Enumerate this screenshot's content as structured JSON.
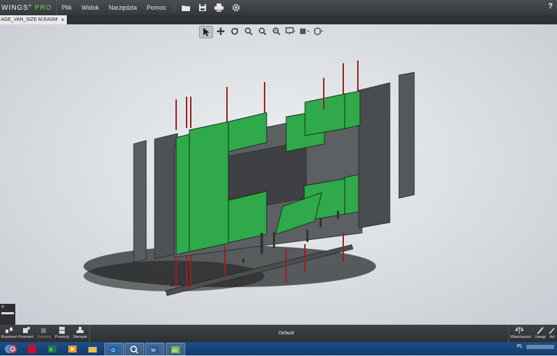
{
  "app": {
    "brand_name": "WINGS°",
    "brand_suffix": "PRO"
  },
  "menu": {
    "items": [
      "Plik",
      "Widok",
      "Narzędzia",
      "Pomoc"
    ],
    "help_label": "?"
  },
  "document_tab": {
    "title": "AGE_VAN_SIZE M.EASM",
    "close_label": "×"
  },
  "view_toolbar": {
    "tools": [
      "select-arrow-icon",
      "pan-icon",
      "rotate-icon",
      "zoom-box-icon",
      "zoom-fit-icon",
      "zoom-icon",
      "display-mode-icon",
      "section-view-icon",
      "box-view-icon"
    ],
    "active_tool": "select-arrow-icon"
  },
  "left_panel": {
    "label": "e"
  },
  "bottom_toolbar": {
    "tools": [
      {
        "label": "Rozstrzel",
        "icon": "explode-icon",
        "enabled": true
      },
      {
        "label": "Przenieś",
        "icon": "move-icon",
        "enabled": true
      },
      {
        "label": "Zresetuj",
        "icon": "reset-icon",
        "enabled": false
      },
      {
        "label": "Przekrój",
        "icon": "section-icon",
        "enabled": true
      },
      {
        "label": "Stemple",
        "icon": "stamp-icon",
        "enabled": true
      }
    ],
    "right_tools": [
      {
        "label": "Właściwości",
        "icon": "properties-icon"
      },
      {
        "label": "Uwagi",
        "icon": "markup-pen-icon"
      },
      {
        "label": "Ad",
        "icon": "add-icon"
      }
    ],
    "configuration": "Default"
  },
  "taskbar": {
    "apps": [
      "start-orb-icon",
      "chrome-icon",
      "acrobat-icon",
      "excel-icon",
      "media-player-icon",
      "file-explorer-icon",
      "outlook-icon",
      "search-icon",
      "word-icon",
      "edrawings-icon"
    ],
    "tray_language": "PL"
  },
  "colors": {
    "panel_green": "#2fa94a",
    "panel_grey": "#5a5d60",
    "rod_red": "#9c1d22",
    "bar_dark": "#2d2f33"
  }
}
